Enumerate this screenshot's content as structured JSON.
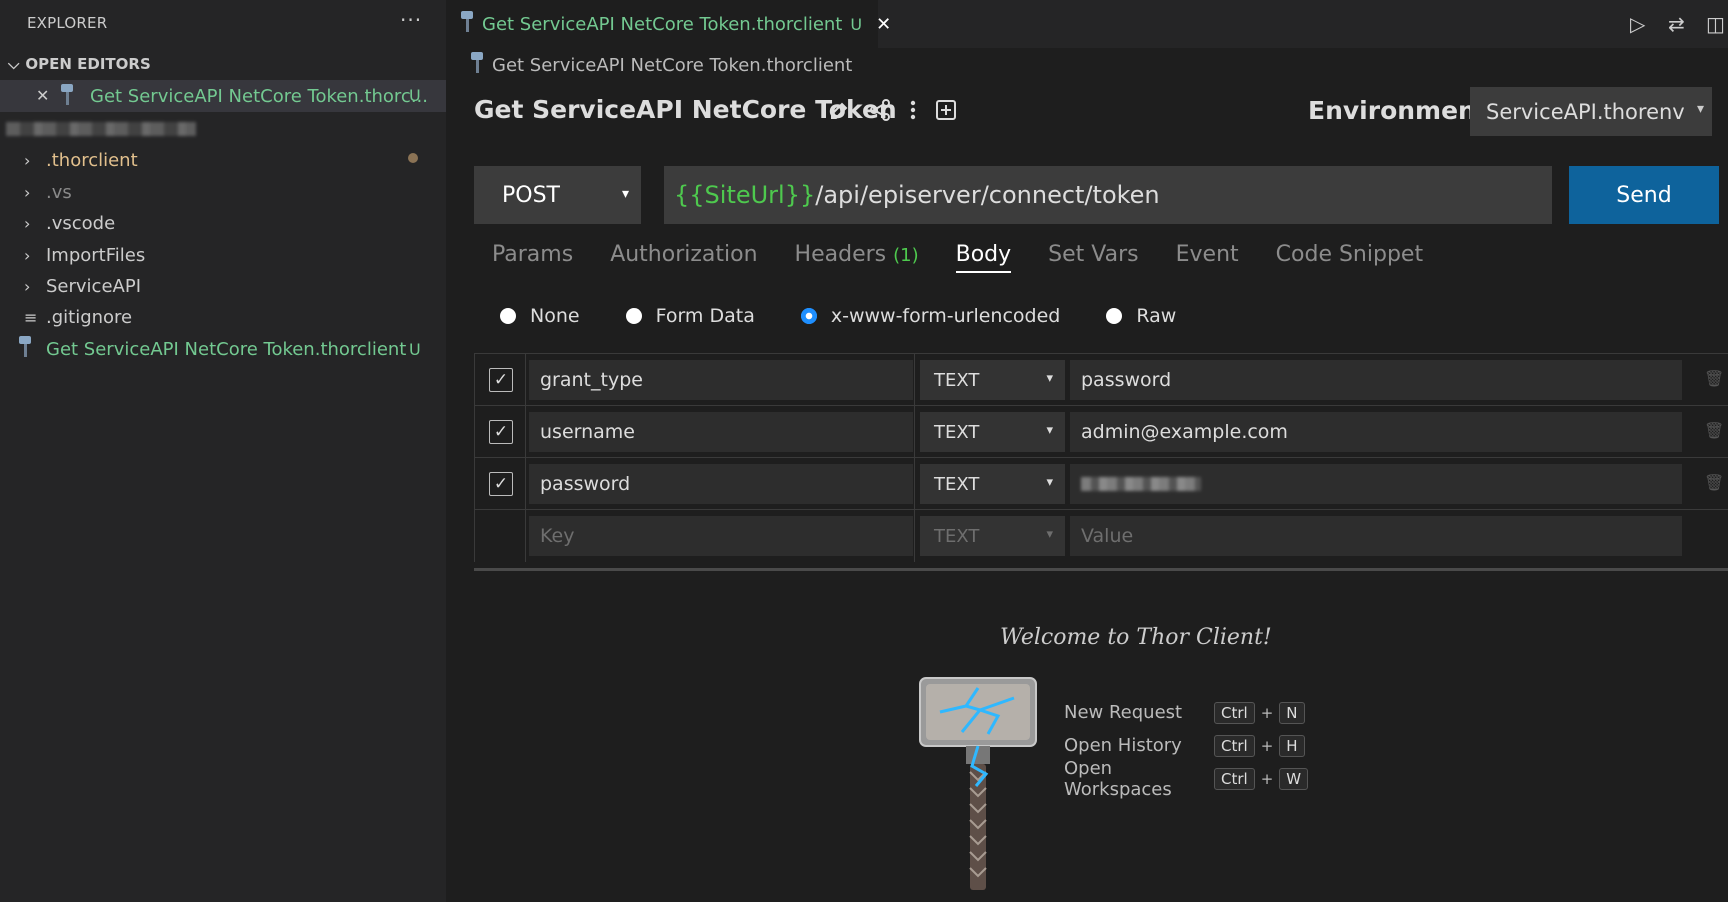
{
  "sidebar": {
    "title": "EXPLORER",
    "more": "···",
    "open_editors": {
      "header": "OPEN EDITORS",
      "items": [
        {
          "name": "Get ServiceAPI NetCore Token.thorc...",
          "status": "U"
        }
      ]
    },
    "tree": [
      {
        "label": ".thorclient",
        "kind": "folder"
      },
      {
        "label": ".vs",
        "kind": "folder"
      },
      {
        "label": ".vscode",
        "kind": "folder"
      },
      {
        "label": "ImportFiles",
        "kind": "folder"
      },
      {
        "label": "ServiceAPI",
        "kind": "folder"
      },
      {
        "label": ".gitignore",
        "kind": "file"
      },
      {
        "label": "Get ServiceAPI NetCore Token.thorclient",
        "kind": "thorclient",
        "status": "U"
      }
    ]
  },
  "editor_tab": {
    "label": "Get ServiceAPI NetCore Token.thorclient",
    "status": "U"
  },
  "breadcrumb": "Get ServiceAPI NetCore Token.thorclient",
  "request": {
    "title": "Get ServiceAPI NetCore Token",
    "environment_label": "Environment:",
    "environment_value": "ServiceAPI.thorenv",
    "method": "POST",
    "url_variable": "{{SiteUrl}}",
    "url_path": "/api/episerver/connect/token",
    "send_label": "Send",
    "tabs": [
      "Params",
      "Authorization",
      "Headers",
      "Body",
      "Set Vars",
      "Event",
      "Code Snippet"
    ],
    "headers_badge": "(1)",
    "active_tab": "Body",
    "body_types": [
      "None",
      "Form Data",
      "x-www-form-urlencoded",
      "Raw"
    ],
    "selected_body_type": "x-www-form-urlencoded",
    "form_rows": [
      {
        "key": "grant_type",
        "type": "TEXT",
        "value": "password",
        "checked": true
      },
      {
        "key": "username",
        "type": "TEXT",
        "value": "admin@example.com",
        "checked": true
      },
      {
        "key": "password",
        "type": "TEXT",
        "value": "",
        "checked": true
      }
    ],
    "new_row": {
      "key_placeholder": "Key",
      "type": "TEXT",
      "value_placeholder": "Value"
    }
  },
  "welcome": {
    "title": "Welcome to Thor Client!",
    "shortcuts": [
      {
        "label": "New Request",
        "mod": "Ctrl",
        "plus": "+",
        "key": "N"
      },
      {
        "label": "Open History",
        "mod": "Ctrl",
        "plus": "+",
        "key": "H"
      },
      {
        "label": "Open Workspaces",
        "mod": "Ctrl",
        "plus": "+",
        "key": "W"
      }
    ]
  },
  "colors": {
    "accent_green": "#4ec94e",
    "git_untracked": "#73c991",
    "send_blue": "#0e639c",
    "radio_blue": "#1e8fff"
  }
}
